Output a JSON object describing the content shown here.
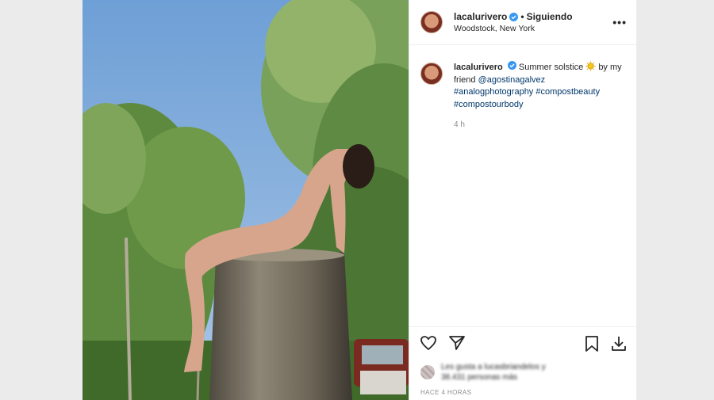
{
  "post": {
    "username": "lacalurivero",
    "following_label": "Siguiendo",
    "location": "Woodstock, New York",
    "caption_text": "Summer solstice",
    "caption_by": "by my friend",
    "mention": "@agostinagalvez",
    "hashtags": [
      "#analogphotography",
      "#compostbeauty",
      "#compostourbody"
    ],
    "time_ago": "4 h",
    "posted_label": "HACE 4 HORAS",
    "likes_blurred_line1": "Les gusta a lucasbriandelos y",
    "likes_blurred_line2": "38.431 personas más"
  },
  "icons": {
    "more": "more-options-icon",
    "verified": "verified-badge-icon",
    "like": "heart-icon",
    "share": "paper-plane-icon",
    "save": "bookmark-icon",
    "download": "download-icon",
    "sun": "sun-emoji"
  },
  "colors": {
    "link": "#00376b",
    "verified": "#3897f0",
    "muted": "#8e8e8e",
    "text": "#262626"
  }
}
